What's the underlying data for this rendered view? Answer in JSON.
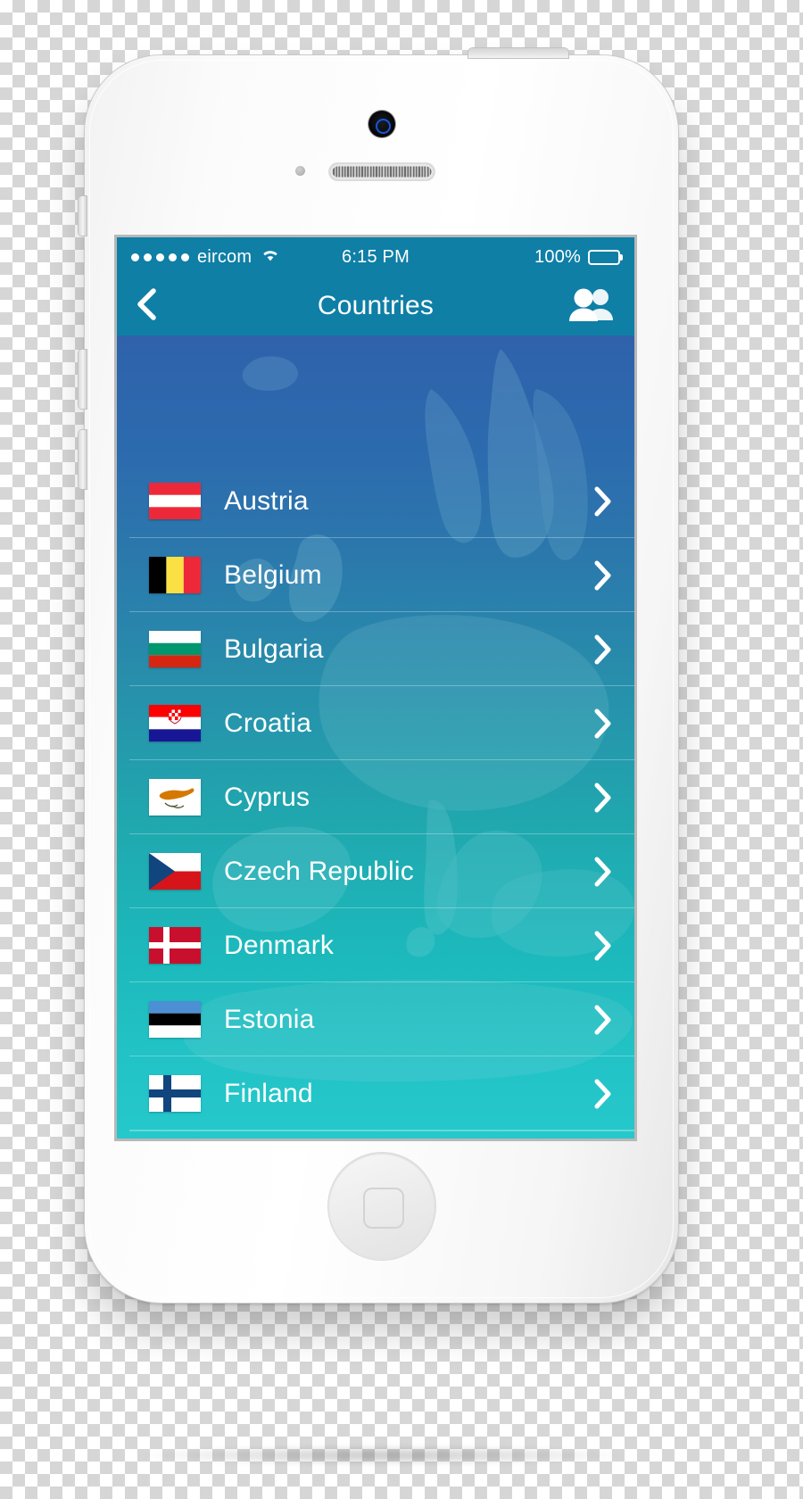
{
  "device": {
    "name": "iphone-5-white",
    "camera_icon": "camera-lens",
    "speaker_icon": "earpiece-speaker",
    "home_button_icon": "home-square",
    "buttons": [
      "silent-switch",
      "volume-up",
      "volume-down",
      "power"
    ]
  },
  "status_bar": {
    "signal_dots": 5,
    "carrier": "eircom",
    "wifi_icon": "wifi-icon",
    "time": "6:15 PM",
    "battery_percent": "100%",
    "battery_level": 100,
    "background": "#0f7fa6",
    "text_color": "#ffffff"
  },
  "nav_bar": {
    "back_icon": "chevron-left-icon",
    "title": "Countries",
    "people_icon": "people-icon",
    "background": "#0f7fa6"
  },
  "list": {
    "disclosure_icon": "chevron-right-icon",
    "background_image": "europe-map",
    "gradient_top": "#2f62ab",
    "gradient_bottom": "#25c8cb",
    "items": [
      {
        "name": "Austria",
        "flag": "flag-austria"
      },
      {
        "name": "Belgium",
        "flag": "flag-belgium"
      },
      {
        "name": "Bulgaria",
        "flag": "flag-bulgaria"
      },
      {
        "name": "Croatia",
        "flag": "flag-croatia"
      },
      {
        "name": "Cyprus",
        "flag": "flag-cyprus"
      },
      {
        "name": "Czech Republic",
        "flag": "flag-czech-republic"
      },
      {
        "name": "Denmark",
        "flag": "flag-denmark"
      },
      {
        "name": "Estonia",
        "flag": "flag-estonia"
      },
      {
        "name": "Finland",
        "flag": "flag-finland"
      }
    ]
  }
}
